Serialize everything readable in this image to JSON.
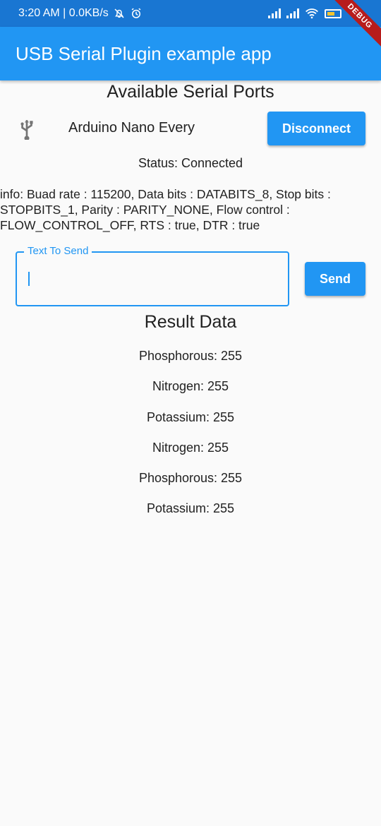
{
  "status_bar": {
    "time_and_speed": "3:20 AM | 0.0KB/s"
  },
  "debug_banner": "DEBUG",
  "app_bar": {
    "title": "USB Serial Plugin example app"
  },
  "ports": {
    "title": "Available Serial Ports",
    "items": [
      {
        "name": "Arduino Nano Every",
        "action_label": "Disconnect"
      }
    ]
  },
  "status": "Status: Connected",
  "info": "info: Buad rate : 115200, Data bits : DATABITS_8, Stop bits : STOPBITS_1, Parity : PARITY_NONE, Flow control : FLOW_CONTROL_OFF, RTS : true, DTR : true",
  "send": {
    "label": "Text To Send",
    "value": "",
    "button_label": "Send"
  },
  "result": {
    "title": "Result Data",
    "items": [
      "Phosphorous: 255",
      "Nitrogen: 255",
      "Potassium: 255",
      "Nitrogen: 255",
      "Phosphorous: 255",
      "Potassium: 255"
    ]
  },
  "colors": {
    "primary": "#2196f3",
    "status_bar": "#1976d2",
    "background": "#fafafa"
  }
}
